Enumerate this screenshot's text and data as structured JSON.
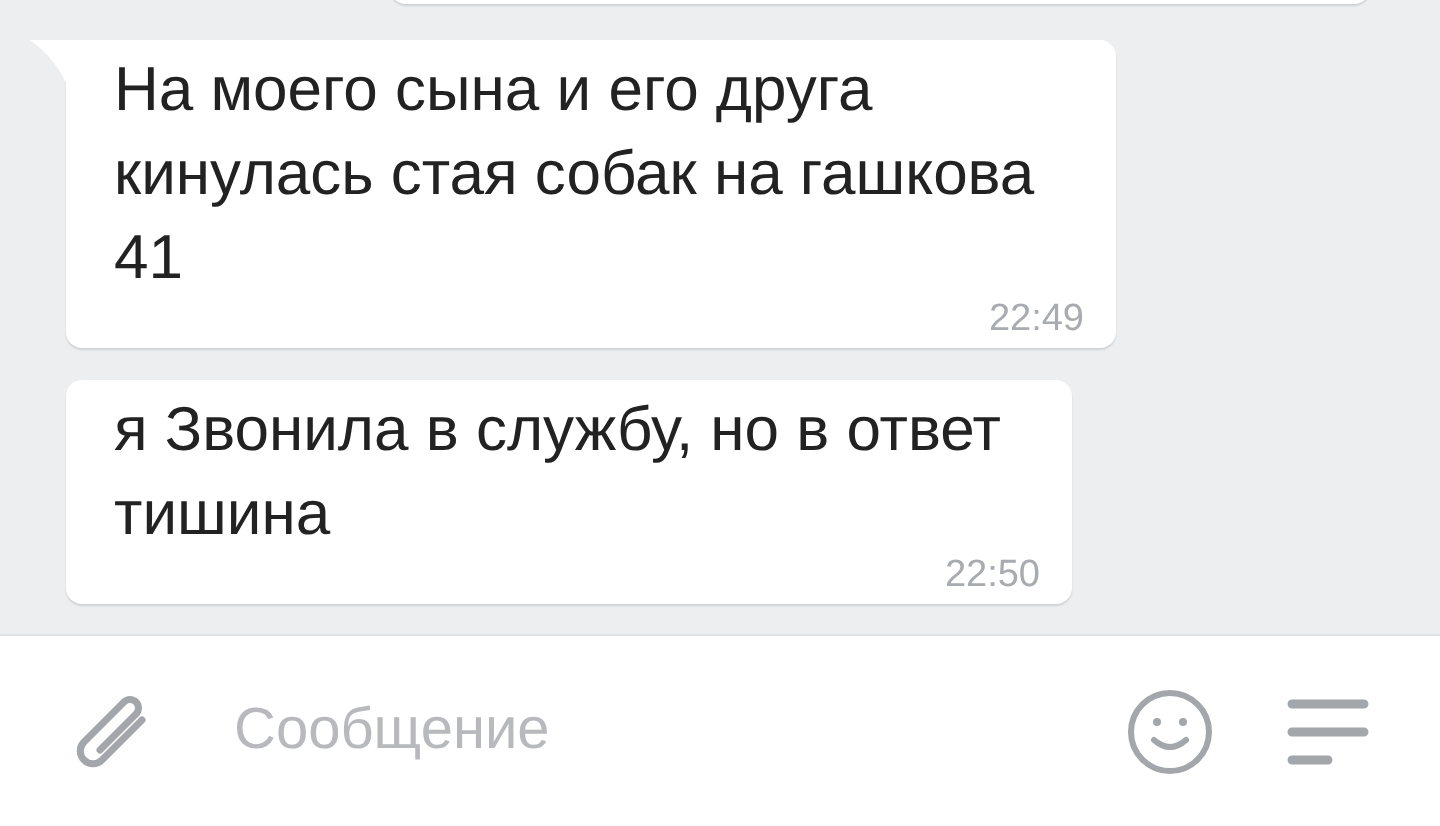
{
  "messages": [
    {
      "text": "На моего сына и его друга кинулась стая собак на гашкова 41",
      "time": "22:49"
    },
    {
      "text": "я Звонила в службу, но в ответ тишина",
      "time": "22:50"
    }
  ],
  "composer": {
    "placeholder": "Сообщение"
  }
}
